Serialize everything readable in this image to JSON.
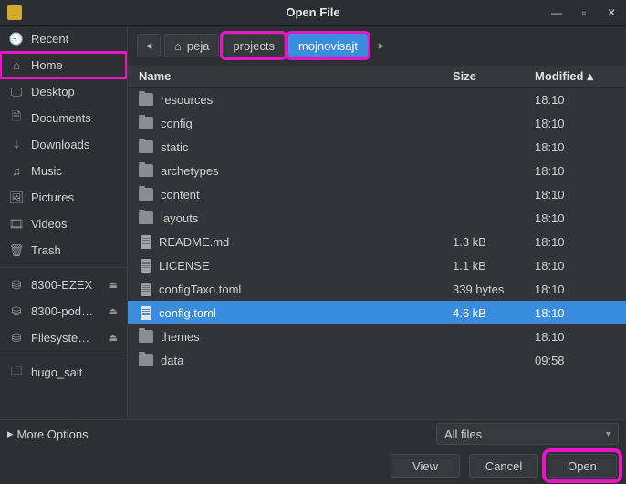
{
  "window": {
    "title": "Open File"
  },
  "sidebar": {
    "items": [
      {
        "id": "recent",
        "label": "Recent",
        "icon": "clock-icon"
      },
      {
        "id": "home",
        "label": "Home",
        "icon": "home-icon",
        "highlighted": true
      },
      {
        "id": "desktop",
        "label": "Desktop",
        "icon": "desktop-icon"
      },
      {
        "id": "documents",
        "label": "Documents",
        "icon": "documents-icon"
      },
      {
        "id": "downloads",
        "label": "Downloads",
        "icon": "downloads-icon"
      },
      {
        "id": "music",
        "label": "Music",
        "icon": "music-icon"
      },
      {
        "id": "pictures",
        "label": "Pictures",
        "icon": "pictures-icon"
      },
      {
        "id": "videos",
        "label": "Videos",
        "icon": "videos-icon"
      },
      {
        "id": "trash",
        "label": "Trash",
        "icon": "trash-icon"
      }
    ],
    "devices": [
      {
        "id": "dev1",
        "label": "8300-EZEX",
        "icon": "drive-icon",
        "eject": true
      },
      {
        "id": "dev2",
        "label": "8300-pod…",
        "icon": "drive-icon",
        "eject": true
      },
      {
        "id": "dev3",
        "label": "Filesyste…",
        "icon": "drive-icon",
        "eject": true
      }
    ],
    "extra": [
      {
        "id": "hugo",
        "label": "hugo_sait",
        "icon": "folder-icon"
      }
    ]
  },
  "path": {
    "segments": [
      {
        "id": "peja",
        "label": "peja",
        "home": true
      },
      {
        "id": "projects",
        "label": "projects",
        "highlighted": true
      },
      {
        "id": "current",
        "label": "mojnovisajt",
        "active": true,
        "highlighted": true
      }
    ]
  },
  "columns": {
    "name": "Name",
    "size": "Size",
    "modified": "Modified"
  },
  "files": [
    {
      "name": "resources",
      "type": "folder",
      "size": "",
      "modified": "18:10"
    },
    {
      "name": "config",
      "type": "folder",
      "size": "",
      "modified": "18:10"
    },
    {
      "name": "static",
      "type": "folder",
      "size": "",
      "modified": "18:10"
    },
    {
      "name": "archetypes",
      "type": "folder",
      "size": "",
      "modified": "18:10"
    },
    {
      "name": "content",
      "type": "folder",
      "size": "",
      "modified": "18:10"
    },
    {
      "name": "layouts",
      "type": "folder",
      "size": "",
      "modified": "18:10"
    },
    {
      "name": "README.md",
      "type": "file",
      "size": "1.3 kB",
      "modified": "18:10"
    },
    {
      "name": "LICENSE",
      "type": "file",
      "size": "1.1 kB",
      "modified": "18:10"
    },
    {
      "name": "configTaxo.toml",
      "type": "file",
      "size": "339 bytes",
      "modified": "18:10"
    },
    {
      "name": "config.toml",
      "type": "file",
      "size": "4.6 kB",
      "modified": "18:10",
      "selected": true
    },
    {
      "name": "themes",
      "type": "folder",
      "size": "",
      "modified": "18:10"
    },
    {
      "name": "data",
      "type": "folder",
      "size": "",
      "modified": "09:58"
    }
  ],
  "footer": {
    "more_options": "More Options",
    "filter": "All files",
    "buttons": {
      "view": "View",
      "cancel": "Cancel",
      "open": "Open"
    },
    "open_highlighted": true
  },
  "icons": {
    "clock-icon": "🕘",
    "home-icon": "⌂",
    "desktop-icon": "🖵",
    "documents-icon": "🗎",
    "downloads-icon": "⤓",
    "music-icon": "♫",
    "pictures-icon": "🖼",
    "videos-icon": "🎞",
    "trash-icon": "🗑",
    "drive-icon": "⛁",
    "folder-icon": "🗀"
  }
}
